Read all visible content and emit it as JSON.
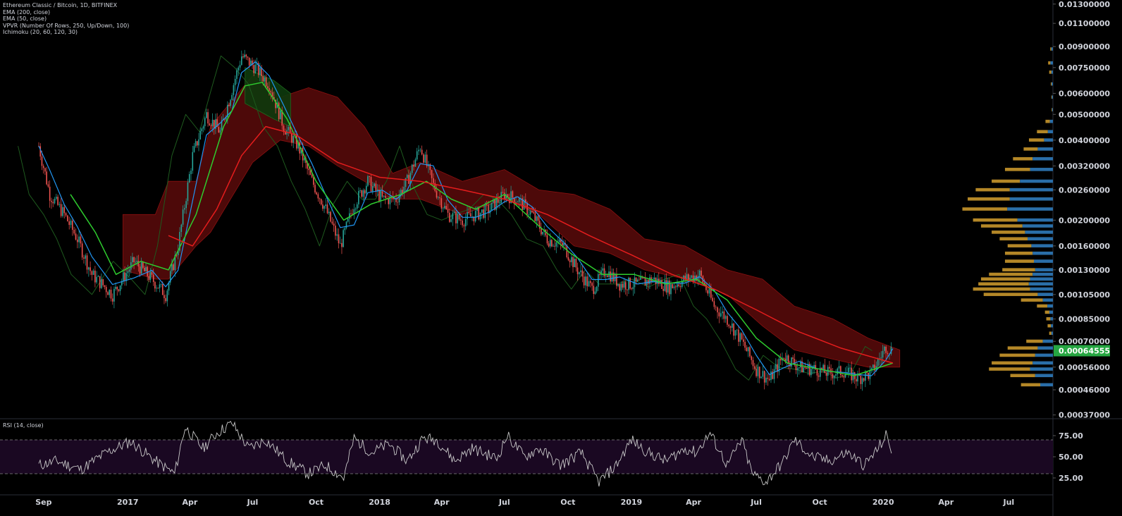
{
  "header": {
    "symbol": "Ethereum Classic / Bitcoin, 1D, BITFINEX",
    "indicators": [
      "EMA (200, close)",
      "EMA (50, close)",
      "VPVR (Number Of Rows, 250, Up/Down, 100)",
      "Ichimoku (20, 60, 120, 30)"
    ]
  },
  "rsi_panel": {
    "label": "RSI (14, close)"
  },
  "colors": {
    "background": "#000000",
    "candle_up": "#26a69a",
    "candle_down": "#ef5350",
    "ema200": "#e51d1d",
    "ema50": "#2ecc2e",
    "tenkan": "#2196f3",
    "lagging": "#1e5a1e",
    "cloud_bear": "#5a0a0a",
    "cloud_bull": "#0d3a0d",
    "vp_up": "#2a6ea8",
    "vp_down": "#c8962b",
    "rsi_line": "#c8c8c8",
    "rsi_band": "#1a0822",
    "last_price_bg": "#26a642"
  },
  "chart_data": [
    {
      "type": "line",
      "title": "Ethereum Classic / Bitcoin, 1D, BITFINEX",
      "scale": "log",
      "price_axis_ticks": [
        "0.01300000",
        "0.01100000",
        "0.00900000",
        "0.00750000",
        "0.00600000",
        "0.00500000",
        "0.00400000",
        "0.00320000",
        "0.00260000",
        "0.00200000",
        "0.00160000",
        "0.00130000",
        "0.00105000",
        "0.00085000",
        "0.00070000",
        "0.00056000",
        "0.00046000",
        "0.00037000"
      ],
      "last_price": "0.00064555",
      "time_axis_labels": [
        "Sep",
        "2017",
        "Apr",
        "Jul",
        "Oct",
        "2018",
        "Apr",
        "Jul",
        "Oct",
        "2019",
        "Apr",
        "Jul",
        "Oct",
        "2020",
        "Apr",
        "Jul"
      ],
      "series": [
        {
          "name": "ETC/BTC close (approx)",
          "x": [
            "2016-08-25",
            "2016-09-10",
            "2016-10-01",
            "2016-10-20",
            "2016-11-10",
            "2016-12-10",
            "2017-01-10",
            "2017-02-05",
            "2017-02-25",
            "2017-03-15",
            "2017-04-05",
            "2017-04-25",
            "2017-05-15",
            "2017-06-01",
            "2017-06-15",
            "2017-07-05",
            "2017-07-25",
            "2017-08-15",
            "2017-09-05",
            "2017-09-25",
            "2017-10-15",
            "2017-11-05",
            "2017-11-25",
            "2017-12-15",
            "2018-01-05",
            "2018-01-25",
            "2018-02-10",
            "2018-03-01",
            "2018-03-20",
            "2018-04-10",
            "2018-05-01",
            "2018-05-20",
            "2018-06-10",
            "2018-07-01",
            "2018-07-20",
            "2018-08-10",
            "2018-09-01",
            "2018-09-25",
            "2018-10-15",
            "2018-11-05",
            "2018-11-25",
            "2018-12-15",
            "2019-01-10",
            "2019-02-01",
            "2019-02-25",
            "2019-03-20",
            "2019-04-10",
            "2019-05-01",
            "2019-05-20",
            "2019-06-10",
            "2019-07-01",
            "2019-07-20",
            "2019-08-10",
            "2019-09-01",
            "2019-09-25",
            "2019-10-15",
            "2019-11-05",
            "2019-11-25",
            "2019-12-15",
            "2020-01-05",
            "2020-01-15"
          ],
          "y": [
            0.0038,
            0.0025,
            0.0021,
            0.0017,
            0.00125,
            0.00105,
            0.0014,
            0.0012,
            0.00105,
            0.0016,
            0.0035,
            0.005,
            0.0043,
            0.0062,
            0.0083,
            0.0075,
            0.0065,
            0.0045,
            0.0038,
            0.0028,
            0.0022,
            0.0016,
            0.0023,
            0.0028,
            0.0024,
            0.0024,
            0.0028,
            0.0038,
            0.0027,
            0.0021,
            0.002,
            0.0021,
            0.0022,
            0.0025,
            0.0024,
            0.0021,
            0.0017,
            0.0016,
            0.0013,
            0.0011,
            0.0013,
            0.00115,
            0.00115,
            0.0012,
            0.00112,
            0.0012,
            0.00125,
            0.00095,
            0.00085,
            0.0007,
            0.00055,
            0.0005,
            0.00062,
            0.00056,
            0.00055,
            0.00053,
            0.00054,
            0.00051,
            0.00053,
            0.00067,
            0.00064555
          ]
        },
        {
          "name": "EMA (200, close) (approx)",
          "x": [
            "2017-03-01",
            "2017-04-05",
            "2017-05-10",
            "2017-06-15",
            "2017-07-20",
            "2017-09-01",
            "2017-11-01",
            "2018-01-01",
            "2018-03-01",
            "2018-05-01",
            "2018-07-01",
            "2018-09-01",
            "2018-11-01",
            "2019-01-01",
            "2019-03-01",
            "2019-05-01",
            "2019-07-01",
            "2019-09-01",
            "2019-11-01",
            "2020-01-15"
          ],
          "y": [
            0.00175,
            0.0016,
            0.0022,
            0.0035,
            0.0045,
            0.0042,
            0.0033,
            0.0029,
            0.0028,
            0.0026,
            0.0024,
            0.0021,
            0.00175,
            0.00148,
            0.00125,
            0.0011,
            0.00092,
            0.00076,
            0.00066,
            0.00058
          ]
        },
        {
          "name": "EMA (50, close) (approx)",
          "x": [
            "2016-10-10",
            "2016-11-15",
            "2016-12-15",
            "2017-01-20",
            "2017-03-01",
            "2017-04-10",
            "2017-05-20",
            "2017-06-20",
            "2017-07-15",
            "2017-08-20",
            "2017-10-01",
            "2017-11-10",
            "2017-12-20",
            "2018-02-01",
            "2018-03-10",
            "2018-04-15",
            "2018-05-20",
            "2018-07-01",
            "2018-08-20",
            "2018-10-05",
            "2018-11-20",
            "2019-01-05",
            "2019-02-20",
            "2019-04-05",
            "2019-05-20",
            "2019-07-01",
            "2019-08-15",
            "2019-10-01",
            "2019-11-20",
            "2020-01-15"
          ],
          "y": [
            0.0025,
            0.0018,
            0.00125,
            0.0014,
            0.0013,
            0.0021,
            0.0045,
            0.0064,
            0.0066,
            0.0048,
            0.0028,
            0.002,
            0.0023,
            0.0025,
            0.0028,
            0.0024,
            0.0022,
            0.0025,
            0.0019,
            0.0015,
            0.00125,
            0.00125,
            0.00115,
            0.0012,
            0.001,
            0.00072,
            0.00058,
            0.00055,
            0.00052,
            0.00058
          ]
        },
        {
          "name": "RSI (14, close) (approx)",
          "x": [
            "2016-08-25",
            "2016-09-20",
            "2016-10-25",
            "2016-12-01",
            "2017-01-05",
            "2017-02-10",
            "2017-03-10",
            "2017-03-25",
            "2017-04-20",
            "2017-05-10",
            "2017-06-01",
            "2017-06-25",
            "2017-07-20",
            "2017-08-20",
            "2017-09-20",
            "2017-10-15",
            "2017-11-10",
            "2017-11-25",
            "2017-12-20",
            "2018-01-15",
            "2018-02-10",
            "2018-03-05",
            "2018-03-25",
            "2018-04-20",
            "2018-05-15",
            "2018-06-20",
            "2018-07-05",
            "2018-07-30",
            "2018-08-20",
            "2018-09-20",
            "2018-10-20",
            "2018-11-15",
            "2018-12-10",
            "2019-01-01",
            "2019-01-25",
            "2019-02-20",
            "2019-03-20",
            "2019-04-05",
            "2019-04-25",
            "2019-05-20",
            "2019-06-10",
            "2019-06-25",
            "2019-07-15",
            "2019-08-10",
            "2019-08-25",
            "2019-09-20",
            "2019-10-15",
            "2019-11-10",
            "2019-12-05",
            "2019-12-25",
            "2020-01-05",
            "2020-01-15"
          ],
          "y": [
            40,
            45,
            35,
            55,
            68,
            45,
            30,
            85,
            60,
            78,
            90,
            60,
            70,
            45,
            30,
            40,
            25,
            72,
            55,
            65,
            45,
            72,
            70,
            45,
            60,
            48,
            75,
            50,
            60,
            40,
            55,
            20,
            40,
            70,
            55,
            45,
            60,
            55,
            78,
            40,
            70,
            30,
            20,
            45,
            70,
            50,
            45,
            55,
            40,
            60,
            75,
            55
          ]
        }
      ],
      "rsi_axis_ticks": [
        "75.00",
        "50.00",
        "25.00"
      ],
      "rsi_levels": [
        70,
        30
      ],
      "grid": false
    }
  ]
}
